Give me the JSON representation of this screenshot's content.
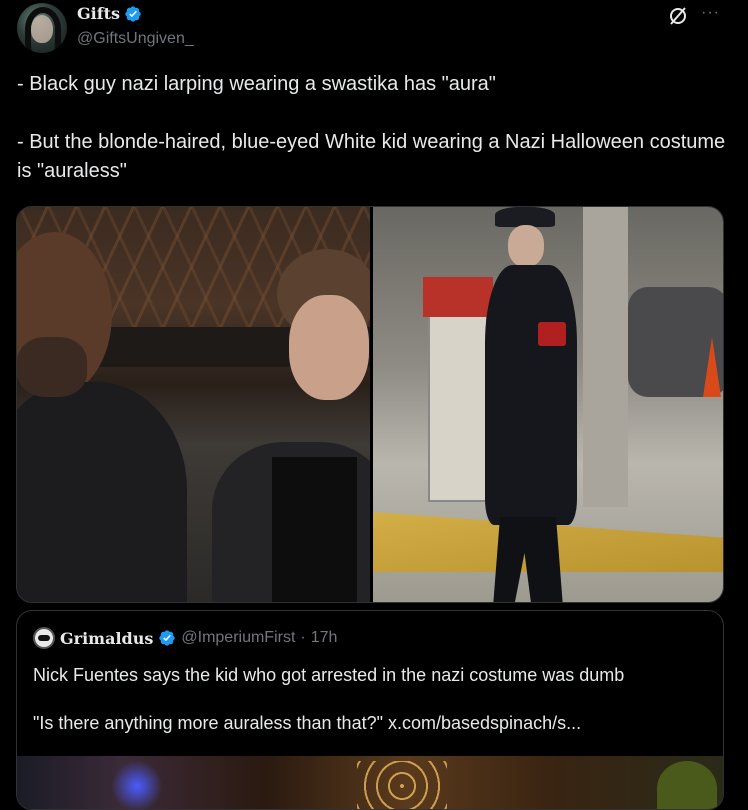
{
  "author": {
    "display_name": "Gifts",
    "handle": "@GiftsUngiven_",
    "verified": true
  },
  "header_icons": [
    "grok-icon",
    "more-icon"
  ],
  "more_label": "···",
  "tweet": {
    "text": "- Black guy nazi larping wearing a swastika has \"aura\"\n\n- But the blonde-haired, blue-eyed White kid wearing a Nazi Halloween costume is \"auraless\""
  },
  "quote": {
    "display_name": "Grimaldus",
    "handle": "@ImperiumFirst",
    "separator": "·",
    "time": "17h",
    "verified": true,
    "text_line1": "Nick Fuentes says the kid who got arrested in the nazi costume was dumb",
    "text_line2": "\"Is there anything more auraless than that?\"",
    "link": "x.com/basedspinach/s..."
  },
  "colors": {
    "background": "#000000",
    "text": "#e7e9ea",
    "secondary": "#71767b",
    "border": "#2f3336",
    "verified_blue": "#1d9bf0"
  }
}
